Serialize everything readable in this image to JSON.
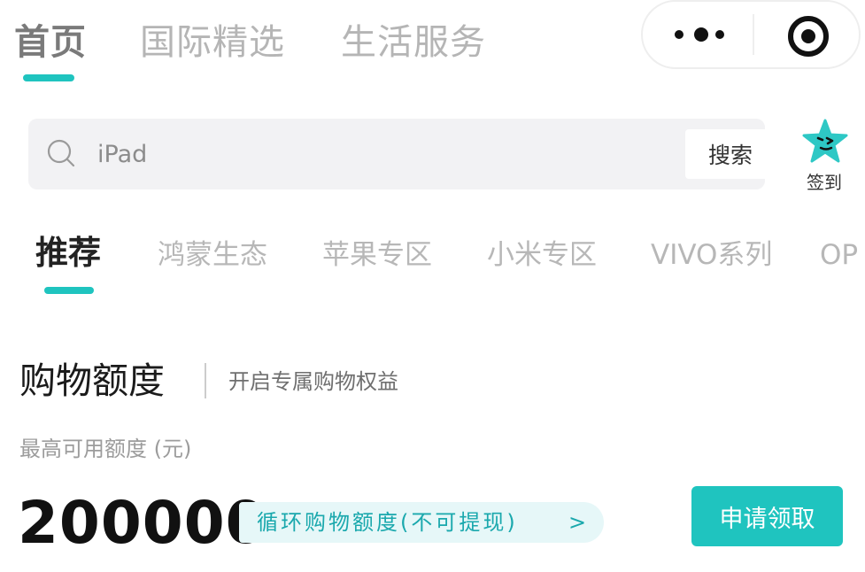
{
  "top_tabs": [
    {
      "label": "首页",
      "active": true
    },
    {
      "label": "国际精选",
      "active": false
    },
    {
      "label": "生活服务",
      "active": false
    }
  ],
  "capsule": {
    "more_icon": "more-dots-icon",
    "close_icon": "target-icon"
  },
  "search": {
    "placeholder": "iPad",
    "button_label": "搜索",
    "icon": "search-icon"
  },
  "signin": {
    "label": "签到",
    "icon": "star-face-icon",
    "color": "#2ec8c5"
  },
  "category_tabs": [
    {
      "label": "推荐",
      "active": true
    },
    {
      "label": "鸿蒙生态",
      "active": false
    },
    {
      "label": "苹果专区",
      "active": false
    },
    {
      "label": "小米专区",
      "active": false
    },
    {
      "label": "VIVO系列",
      "active": false
    },
    {
      "label": "OP",
      "active": false
    }
  ],
  "credit": {
    "title": "购物额度",
    "subtitle": "开启专属购物权益",
    "limit_label": "最高可用额度 (元)",
    "amount": "200000",
    "tag_text": "循环购物额度(不可提现)",
    "tag_arrow": ">",
    "apply_label": "申请领取"
  },
  "colors": {
    "accent": "#1fc4bf",
    "tag_bg": "#e6f7f8",
    "tag_text": "#1aa8ad"
  }
}
